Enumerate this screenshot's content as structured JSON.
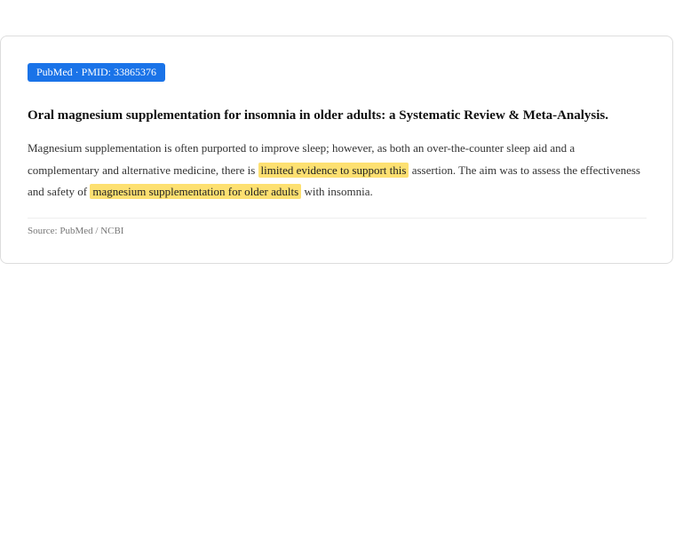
{
  "badge": {
    "label": "PubMed · PMID: 33865376",
    "color": "#1a73e8"
  },
  "article": {
    "title": "Oral magnesium supplementation for insomnia in older adults: a Systematic Review & Meta-Analysis.",
    "abstract": {
      "part1": "Magnesium supplementation is often purported to improve sleep; however, as both an over-the-counter sleep aid and a complementary and alternative medicine, there is ",
      "highlight1": "limited evidence to support this",
      "part2": " assertion. The aim was to assess the effectiveness and safety of ",
      "highlight2": "magnesium supplementation for older adults",
      "part3": " with insomnia."
    },
    "highlight_color": "#fde071"
  },
  "footer": {
    "source": "Source: PubMed / NCBI"
  }
}
